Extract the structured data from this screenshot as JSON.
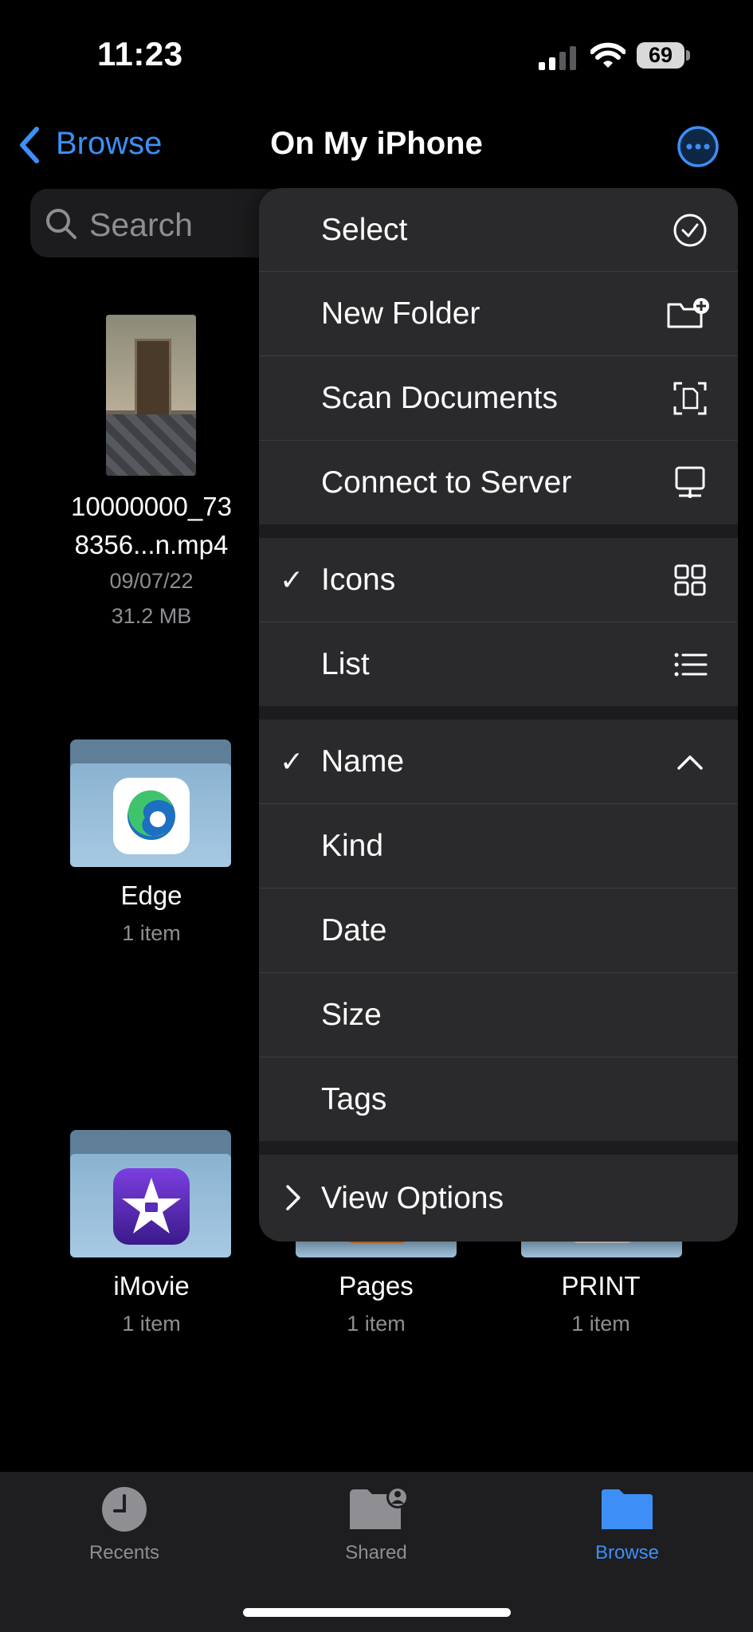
{
  "status_bar": {
    "time": "11:23",
    "battery": "69"
  },
  "nav": {
    "back_label": "Browse",
    "title": "On My iPhone"
  },
  "search": {
    "placeholder": "Search"
  },
  "files": [
    {
      "name_line1": "10000000_73",
      "name_line2": "8356...n.mp4",
      "date": "09/07/22",
      "size": "31.2 MB"
    },
    {
      "name": "Edge",
      "count": "1 item"
    },
    {
      "name": "iMovie",
      "count": "1 item"
    },
    {
      "name": "Pages",
      "count": "1 item"
    },
    {
      "name": "PRINT",
      "count": "1 item"
    }
  ],
  "menu": {
    "actions": [
      "Select",
      "New Folder",
      "Scan Documents",
      "Connect to Server"
    ],
    "view": [
      "Icons",
      "List"
    ],
    "sort": [
      "Name",
      "Kind",
      "Date",
      "Size",
      "Tags"
    ],
    "check": "✓",
    "more": "View Options",
    "selected_view": "Icons",
    "selected_sort": "Name",
    "sort_direction": "ascending"
  },
  "tabs": [
    {
      "label": "Recents",
      "icon": "clock-icon"
    },
    {
      "label": "Shared",
      "icon": "shared-folder-icon"
    },
    {
      "label": "Browse",
      "icon": "folder-icon",
      "active": true
    }
  ],
  "colors": {
    "accent": "#3d8ff7",
    "menu_bg": "#2a2a2c",
    "tab_inactive": "#8e8e93"
  }
}
